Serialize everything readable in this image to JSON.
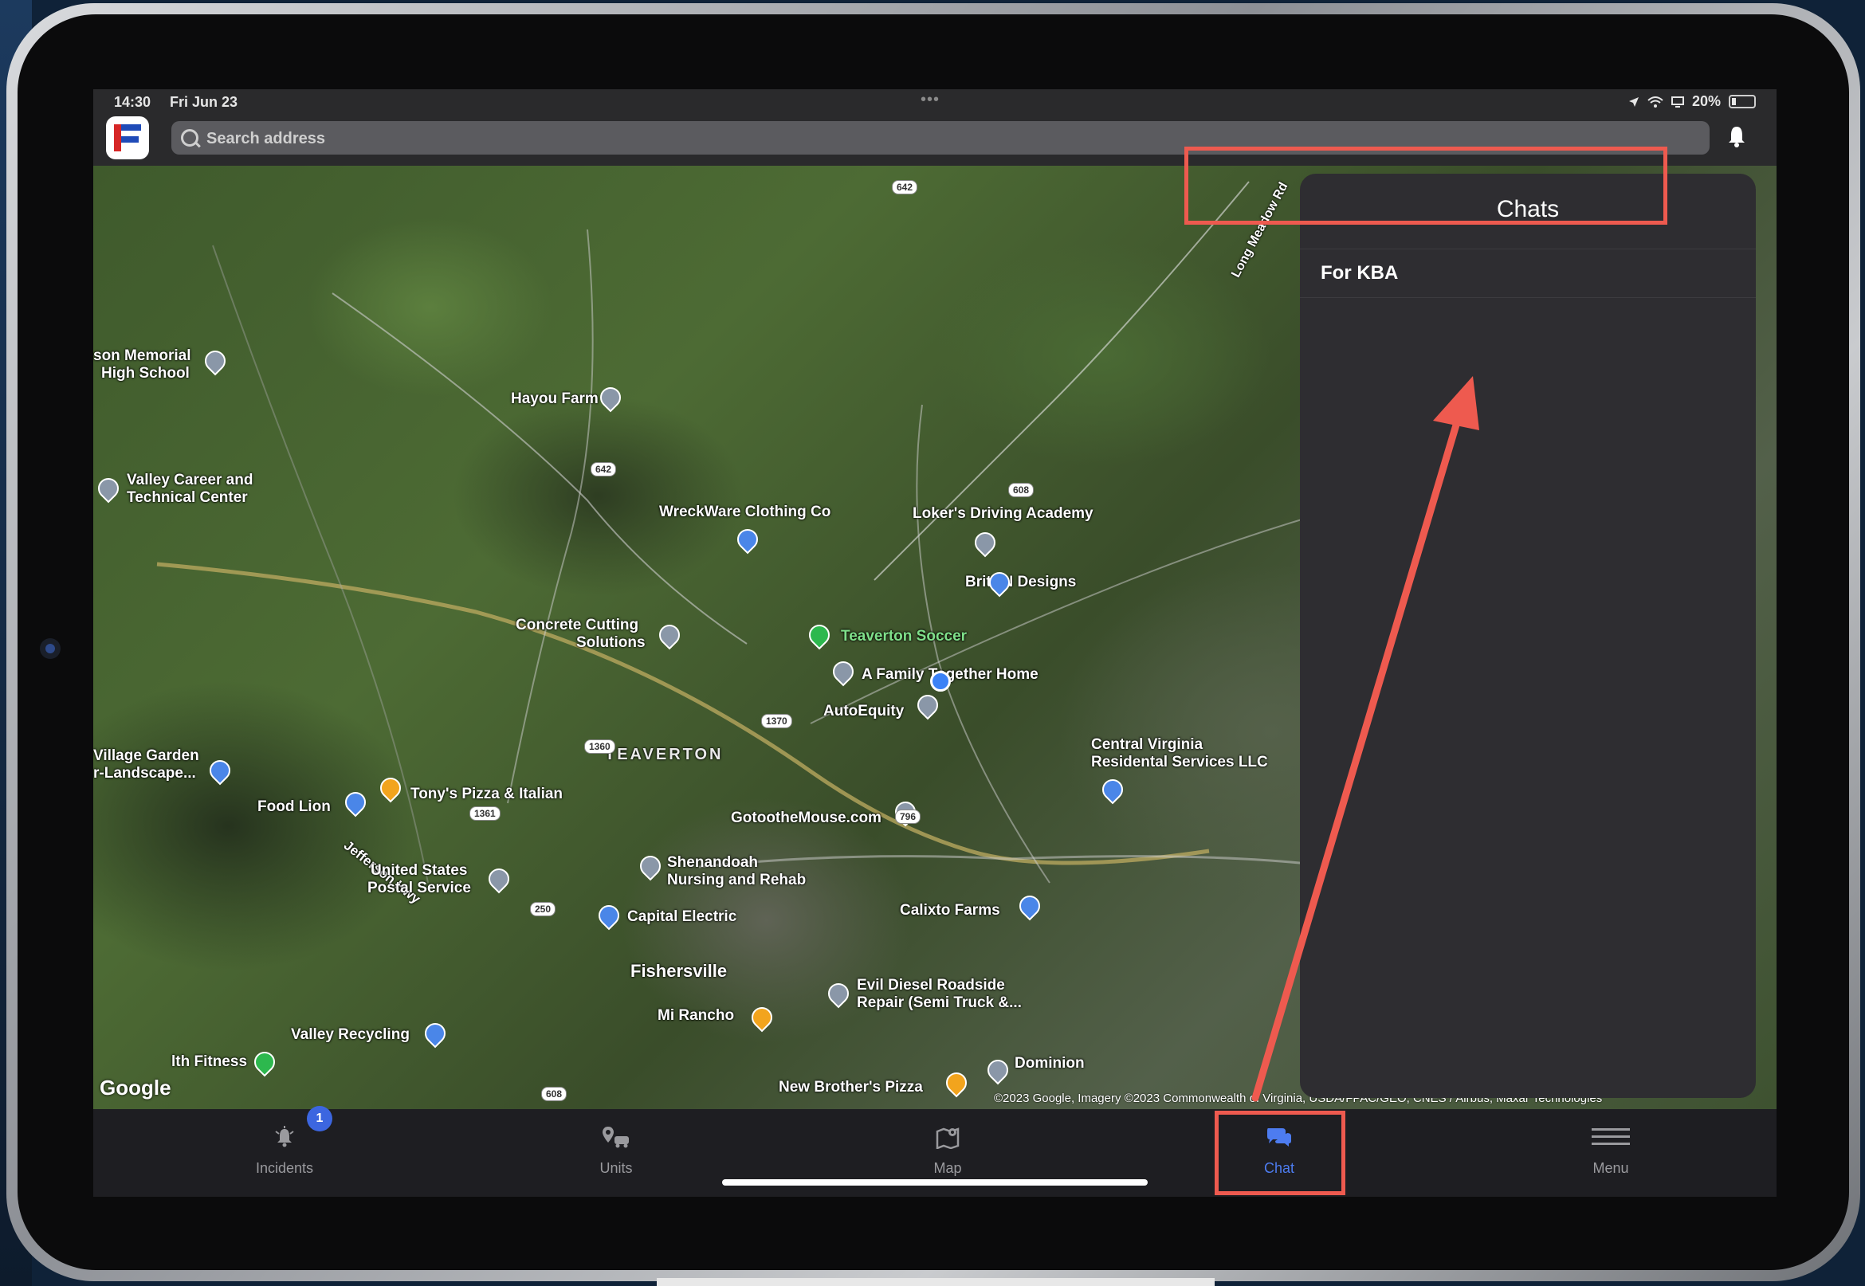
{
  "status_bar": {
    "time": "14:30",
    "date": "Fri Jun 23",
    "dots": "•••",
    "battery_pct": "20%"
  },
  "search": {
    "placeholder": "Search address"
  },
  "icons": {
    "search": "magnifier-icon",
    "notifications": "bell-icon",
    "location": "location-arrow-icon",
    "wifi": "wifi-icon"
  },
  "map": {
    "places": [
      "son Memorial",
      "High School",
      "Hayou Farm",
      "Valley Career and",
      "Technical Center",
      "WreckWare Clothing Co",
      "Loker's Driving Academy",
      "BritRN Designs",
      "Concrete Cutting",
      "Solutions",
      "Teaverton Soccer",
      "A Family Together Home",
      "AutoEquity",
      "Central Virginia",
      "Residental Services LLC",
      "TEAVERTON",
      "Village Garden",
      "r-Landscape...",
      "Food Lion",
      "Tony's Pizza & Italian",
      "Jefferson Hwy",
      "GotootheMouse.com",
      "United States",
      "Postal Service",
      "Shenandoah",
      "Nursing and Rehab",
      "Capital Electric",
      "Calixto Farms",
      "Fishersville",
      "Evil Diesel Roadside",
      "Repair (Semi Truck &...",
      "Mi Rancho",
      "Valley Recycling",
      "lth Fitness",
      "Dominion",
      "New Brother's Pizza",
      "Long Meadow Rd"
    ],
    "route_badges": [
      "642",
      "642",
      "608",
      "1370",
      "1360",
      "1361",
      "796",
      "250",
      "608"
    ],
    "google": "Google",
    "attribution": "©2023 Google, Imagery ©2023 Commonwealth of Virginia, USDA/FPAC/GEO, CNES / Airbus, Maxar Technologies"
  },
  "chats": {
    "title": "Chats",
    "items": [
      {
        "label": "For KBA"
      }
    ]
  },
  "tabs": [
    {
      "label": "Incidents",
      "icon": "bell-alert-icon",
      "badge": "1"
    },
    {
      "label": "Units",
      "icon": "units-icon"
    },
    {
      "label": "Map",
      "icon": "map-icon"
    },
    {
      "label": "Chat",
      "icon": "chat-bubbles-icon"
    },
    {
      "label": "Menu",
      "icon": "hamburger-icon"
    }
  ],
  "colors": {
    "accent": "#4d7cf0",
    "annotation": "#ee5a4f",
    "panel": "#2e2d31"
  }
}
